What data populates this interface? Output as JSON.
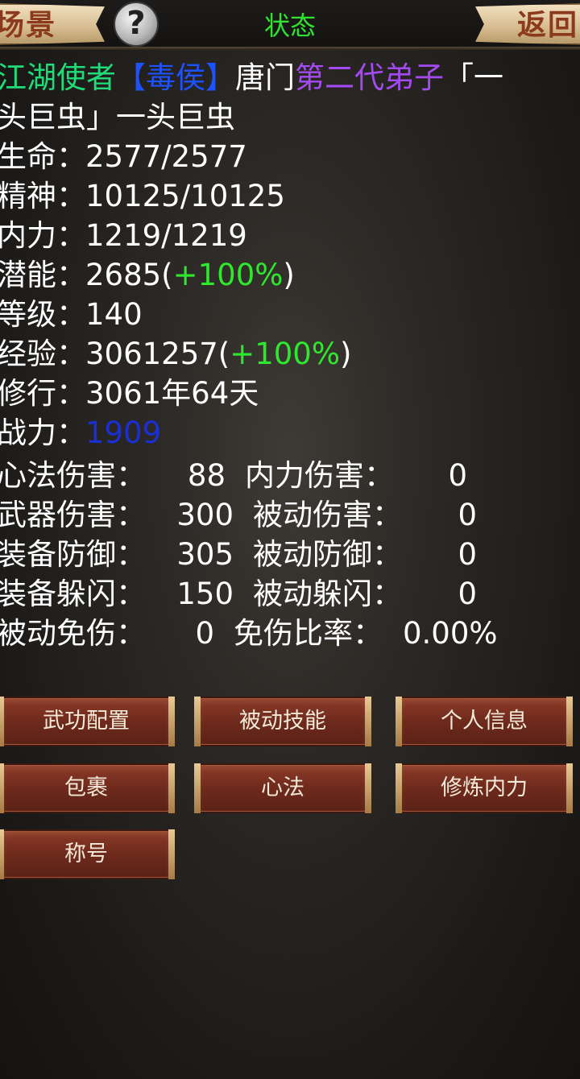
{
  "header": {
    "left_button": "场景",
    "help": "?",
    "title": "状态",
    "right_button": "返回"
  },
  "profile": {
    "seg1": "江湖使者",
    "seg2": "【毒侯】",
    "seg3": "唐门",
    "seg4": "第二代弟子",
    "seg5": "「一",
    "line2": "头巨虫」一头巨虫"
  },
  "attributes": {
    "life": {
      "label": "生命",
      "value": "2577/2577"
    },
    "spirit": {
      "label": "精神",
      "value": "10125/10125"
    },
    "neili": {
      "label": "内力",
      "value": "1219/1219"
    },
    "potential": {
      "label": "潜能",
      "value": "2685(",
      "bonus": "+100%",
      "close": ")"
    },
    "level": {
      "label": "等级",
      "value": "140"
    },
    "exp": {
      "label": "经验",
      "value": "3061257(",
      "bonus": "+100%",
      "close": ")"
    },
    "cultivation": {
      "label": "修行",
      "value": "3061年64天"
    },
    "power": {
      "label": "战力",
      "value": "1909"
    }
  },
  "colon": "：",
  "stats": [
    {
      "l1": "心法伤害：",
      "v1": "88",
      "l2": "内力伤害：",
      "v2": "0"
    },
    {
      "l1": "武器伤害：",
      "v1": "300",
      "l2": "被动伤害：",
      "v2": "0"
    },
    {
      "l1": "装备防御：",
      "v1": "305",
      "l2": "被动防御：",
      "v2": "0"
    },
    {
      "l1": "装备躲闪：",
      "v1": "150",
      "l2": "被动躲闪：",
      "v2": "0"
    },
    {
      "l1": "被动免伤：",
      "v1": "0",
      "l2": "免伤比率：",
      "v2": "0.00%"
    }
  ],
  "buttons": {
    "martial_config": "武功配置",
    "passive_skills": "被动技能",
    "personal_info": "个人信息",
    "bag": "包裹",
    "xinfa": "心法",
    "train_neili": "修炼内力",
    "titles": "称号"
  },
  "colors": {
    "title_green": "#2fe32f",
    "faction_green": "#1fdc79",
    "rank_blue": "#1f52ff",
    "generation_purple": "#a34bf0",
    "bonus_green": "#2ee82e",
    "power_blue": "#1a2fd6",
    "button_red": "#6e2a1c"
  }
}
